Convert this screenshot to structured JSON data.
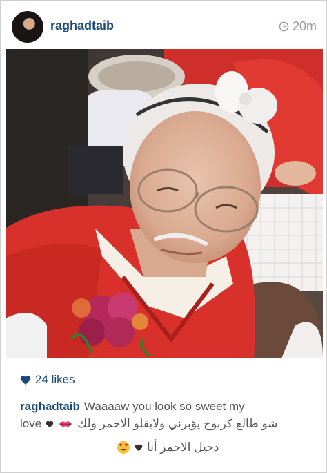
{
  "post": {
    "username": "raghadtaib",
    "time_ago": "20m",
    "likes_text": "24 likes",
    "caption": {
      "username": "raghadtaib",
      "line1_text": "Waaaaw you look so sweet my",
      "line2_love": "love",
      "line2_arabic": "شو طالع كربوج يؤبرني ولابقلو الاحمر ولك",
      "line3_arabic": "دخيل الاحمر أنا"
    }
  },
  "icons": {
    "avatar": "profile-avatar",
    "clock": "clock-icon",
    "likes_heart": "heart-icon",
    "kiss": "kiss-mark-emoji",
    "heart_eyes": "heart-eyes-emoji"
  },
  "colors": {
    "username": "#1a4a7a",
    "time": "#9a9a9a",
    "heart": "#1a4a7a",
    "caption_text": "#555555",
    "sweater_red": "#d8302a"
  }
}
